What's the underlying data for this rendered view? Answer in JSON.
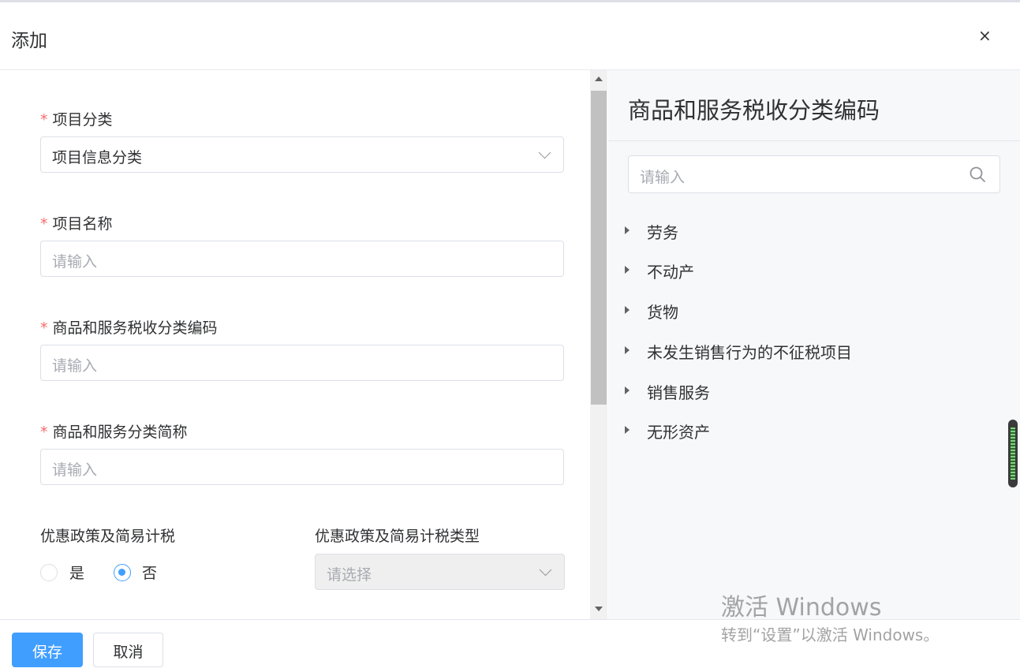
{
  "dialog": {
    "title": "添加",
    "close_glyph": "×"
  },
  "form": {
    "category": {
      "label": "项目分类",
      "value": "项目信息分类"
    },
    "name": {
      "label": "项目名称",
      "placeholder": "请输入"
    },
    "tax_code": {
      "label": "商品和服务税收分类编码",
      "placeholder": "请输入"
    },
    "short_name": {
      "label": "商品和服务分类简称",
      "placeholder": "请输入"
    },
    "preferential": {
      "label": "优惠政策及简易计税",
      "options": [
        "是",
        "否"
      ],
      "selected": "否"
    },
    "preferential_type": {
      "label": "优惠政策及简易计税类型",
      "placeholder": "请选择",
      "disabled": true
    },
    "required_mark": "*"
  },
  "tax_panel": {
    "title": "商品和服务税收分类编码",
    "search_placeholder": "请输入",
    "items": [
      "劳务",
      "不动产",
      "货物",
      "未发生销售行为的不征税项目",
      "销售服务",
      "无形资产"
    ]
  },
  "footer": {
    "save_label": "保存",
    "cancel_label": "取消"
  },
  "watermark": {
    "line1": "激活 Windows",
    "line2": "转到“设置”以激活 Windows。"
  },
  "colors": {
    "primary": "#409eff",
    "required": "#f56c6c",
    "placeholder": "#a8abb2"
  },
  "icons": {
    "close": "close-icon",
    "dropdown": "chevron-down-icon",
    "search": "search-icon",
    "tree_expand": "caret-right-icon"
  }
}
